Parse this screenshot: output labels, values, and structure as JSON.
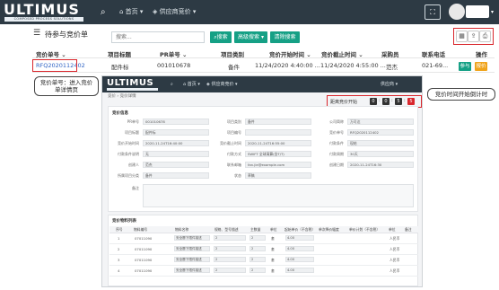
{
  "topbar": {
    "logo_word": "ULTIMUS",
    "logo_tag": "COMPOSED PROCESS SOLUTIONS",
    "menu_home": "首页",
    "menu_supplier": "供应商竞价"
  },
  "header": {
    "title": "待参与竞价单",
    "search_placeholder": "搜索...",
    "search_btn": "搜索",
    "advanced_btn": "高级搜索",
    "clear_btn": "清除搜索"
  },
  "table": {
    "columns": [
      "竞价单号",
      "项目标题",
      "PR单号",
      "项目类别",
      "竞价开始时间",
      "竞价截止时间",
      "采购员",
      "联系电话",
      "操作"
    ],
    "rows": [
      {
        "bid_no": "RFQ2020112402",
        "title": "配件标",
        "pr_no": "001010678",
        "category": "备件",
        "start": "11/24/2020 4:40:00 ...",
        "end": "11/24/2020 4:55:00 ...",
        "buyer": "范杰",
        "phone": "021-69...",
        "action_join": "参与",
        "action_other": "报价"
      }
    ]
  },
  "callouts": {
    "left": "竞价单号：进入竞价单详情页",
    "right": "竞价时间开始倒计时"
  },
  "detail": {
    "logo_word": "ULTIMUS",
    "menu_home": "首页",
    "menu_supplier": "供应商竞价",
    "user": "供应商",
    "crumb": "竞价 ›  竞价详情",
    "timer_label": "距离竞价开始",
    "timer_values": [
      "0",
      "0",
      "5",
      "5"
    ],
    "section_info": "竞价信息",
    "fields": [
      {
        "label": "PR单号",
        "value": "001010678"
      },
      {
        "label": "项目类别",
        "value": "备件"
      },
      {
        "label": "公司简称",
        "value": "万可达"
      },
      {
        "label": "项目标题",
        "value": "配件标"
      },
      {
        "label": "项目编号",
        "value": ""
      },
      {
        "label": "竞价单号",
        "value": "RFQ2020112402"
      },
      {
        "label": "竞价开始时间",
        "value": "2020-11-24T16:40:00"
      },
      {
        "label": "竞价截止时间",
        "value": "2020-11-24T16:55:00"
      },
      {
        "label": "付款条件",
        "value": "现结"
      },
      {
        "label": "付款条件说明",
        "value": "无"
      },
      {
        "label": "付款方式",
        "value": "SWIFT 全球清算(含T/T)"
      },
      {
        "label": "付款周期",
        "value": "30天"
      },
      {
        "label": "创建人",
        "value": "范杰"
      },
      {
        "label": "联系邮箱",
        "value": "fan.jie@example.com"
      },
      {
        "label": "创建日期",
        "value": "2020-11-24T16:30"
      },
      {
        "label": "所属项目分类",
        "value": "备件"
      },
      {
        "label": "状态",
        "value": "草稿"
      },
      {
        "label": "备注",
        "value": ""
      }
    ],
    "section_items": "竞价物料列表",
    "item_columns": [
      "序号",
      "物料编号",
      "物料名称",
      "规格、型号描述",
      "主数量",
      "单位",
      "起始单价（不含税）",
      "单次降价幅度",
      "单价计划（不含税）",
      "单位",
      "备注"
    ],
    "item_rows": [
      {
        "no": "1",
        "code": "07011090",
        "name": "安全履下限件描述",
        "spec": "2",
        "qty": "2",
        "unit": "套",
        "price": "4.00",
        "cur": "人民币"
      },
      {
        "no": "2",
        "code": "07011090",
        "name": "安全履下限件描述",
        "spec": "2",
        "qty": "2",
        "unit": "套",
        "price": "4.00",
        "cur": "人民币"
      },
      {
        "no": "3",
        "code": "07011090",
        "name": "安全履下限件描述",
        "spec": "2",
        "qty": "2",
        "unit": "套",
        "price": "4.00",
        "cur": "人民币"
      },
      {
        "no": "4",
        "code": "07011090",
        "name": "安全履下限件描述",
        "spec": "2",
        "qty": "2",
        "unit": "套",
        "price": "4.00",
        "cur": "人民币"
      }
    ]
  },
  "colors": {
    "topbar": "#2d3a44",
    "accent_green": "#15a085",
    "link_blue": "#2f63c4",
    "highlight_red": "#d9262c",
    "btn_orange": "#f0a31a"
  }
}
